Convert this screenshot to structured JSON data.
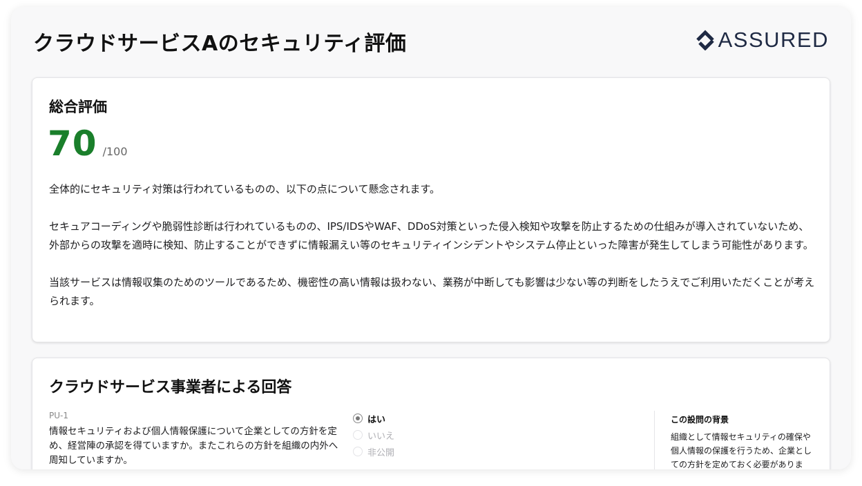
{
  "page": {
    "title": "クラウドサービスAのセキュリティ評価"
  },
  "brand": {
    "name": "ASSURED",
    "icon": "assured-logo-icon",
    "color": "#1f2a44"
  },
  "summary": {
    "title": "総合評価",
    "score": "70",
    "score_max": "/100",
    "score_color": "#1a7f2b",
    "paragraphs": [
      "全体的にセキュリティ対策は行われているものの、以下の点について懸念されます。",
      "セキュアコーディングや脆弱性診断は行われているものの、IPS/IDSやWAF、DDoS対策といった侵入検知や攻撃を防止するための仕組みが導入されていないため、外部からの攻撃を適時に検知、防止することができずに情報漏えい等のセキュリティインシデントやシステム停止といった障害が発生してしまう可能性があります。",
      "当該サービスは情報収集のためのツールであるため、機密性の高い情報は扱わない、業務が中断しても影響は少ない等の判断をしたうえでご利用いただくことが考えられます。"
    ]
  },
  "answers": {
    "title": "クラウドサービス事業者による回答",
    "question": {
      "id": "PU-1",
      "text": "情報セキュリティおよび個人情報保護について企業としての方針を定め、経営陣の承認を得ていますか。またこれらの方針を組織の内外へ周知していますか。",
      "options": [
        {
          "label": "はい",
          "selected": true
        },
        {
          "label": "いいえ",
          "selected": false
        },
        {
          "label": "非公開",
          "selected": false
        }
      ],
      "background_title": "この設問の背景",
      "background_text": "組織として情報セキュリティの確保や個人情報の保護を行うため、企業としての方針を定めておく必要があります。"
    }
  }
}
